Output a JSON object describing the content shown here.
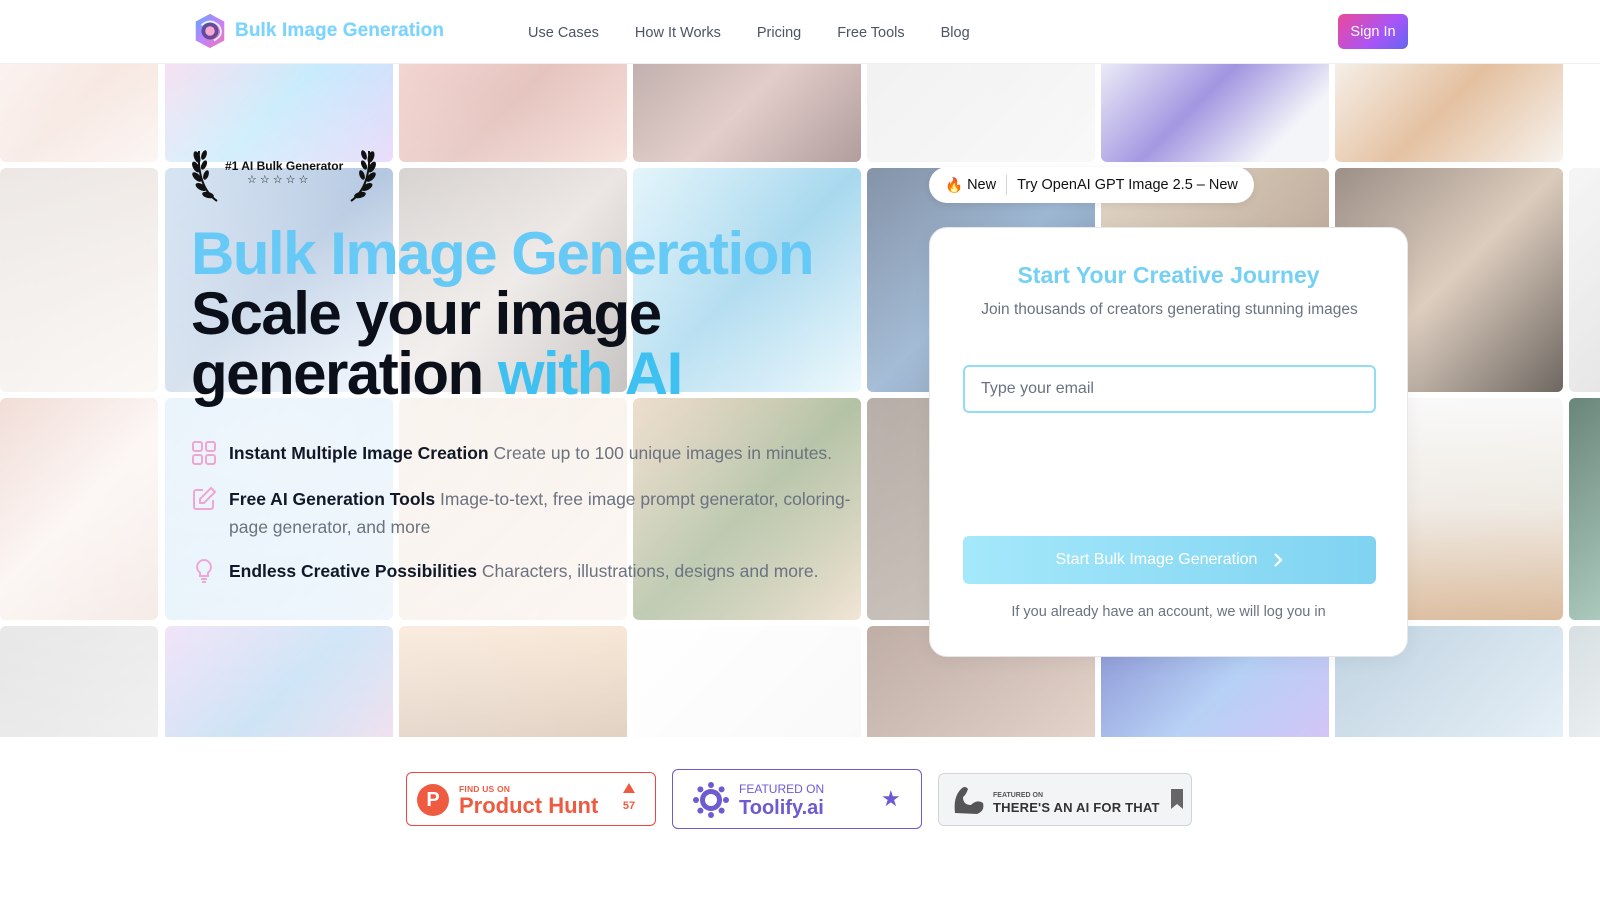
{
  "brand": {
    "name": "Bulk Image Generation"
  },
  "nav": {
    "items": [
      "Use Cases",
      "How It Works",
      "Pricing",
      "Free Tools",
      "Blog"
    ],
    "signin_label": "Sign In"
  },
  "award": {
    "title": "#1 AI Bulk Generator",
    "stars": "☆☆☆☆☆"
  },
  "hero": {
    "title_line1": "Bulk Image Generation",
    "title_line2": "Scale your image",
    "title_line3_prefix": "generation ",
    "title_line3_accent": "with AI"
  },
  "features": [
    {
      "icon": "grid-icon",
      "title": "Instant Multiple Image Creation",
      "desc": "Create up to 100 unique images in minutes."
    },
    {
      "icon": "edit-icon",
      "title": "Free AI Generation Tools",
      "desc": "Image-to-text, free image prompt generator, coloring-page generator, and more"
    },
    {
      "icon": "lightbulb-icon",
      "title": "Endless Creative Possibilities",
      "desc": "Characters, illustrations, designs and more."
    }
  ],
  "announcement": {
    "emoji": "🔥",
    "tag": "New",
    "text": "Try OpenAI GPT Image 2.5 – New"
  },
  "signup": {
    "title": "Start Your Creative Journey",
    "subtitle": "Join thousands of creators generating stunning images",
    "email_placeholder": "Type your email",
    "email_value": "",
    "cta_label": "Start Bulk Image Generation",
    "note": "If you already have an account, we will log you in"
  },
  "badges": {
    "producthunt": {
      "small": "FIND US ON",
      "big": "Product Hunt",
      "count": "57"
    },
    "toolify": {
      "small": "FEATURED ON",
      "big": "Toolify.ai"
    },
    "aiforthat": {
      "small": "FEATURED ON",
      "big": "THERE'S AN AI FOR THAT"
    }
  },
  "colors": {
    "accent": "#67c9f5",
    "signin_gradient_start": "#ec4899",
    "signin_gradient_end": "#6366f1",
    "producthunt": "#ef5b41",
    "toolify": "#6d5bd0"
  }
}
